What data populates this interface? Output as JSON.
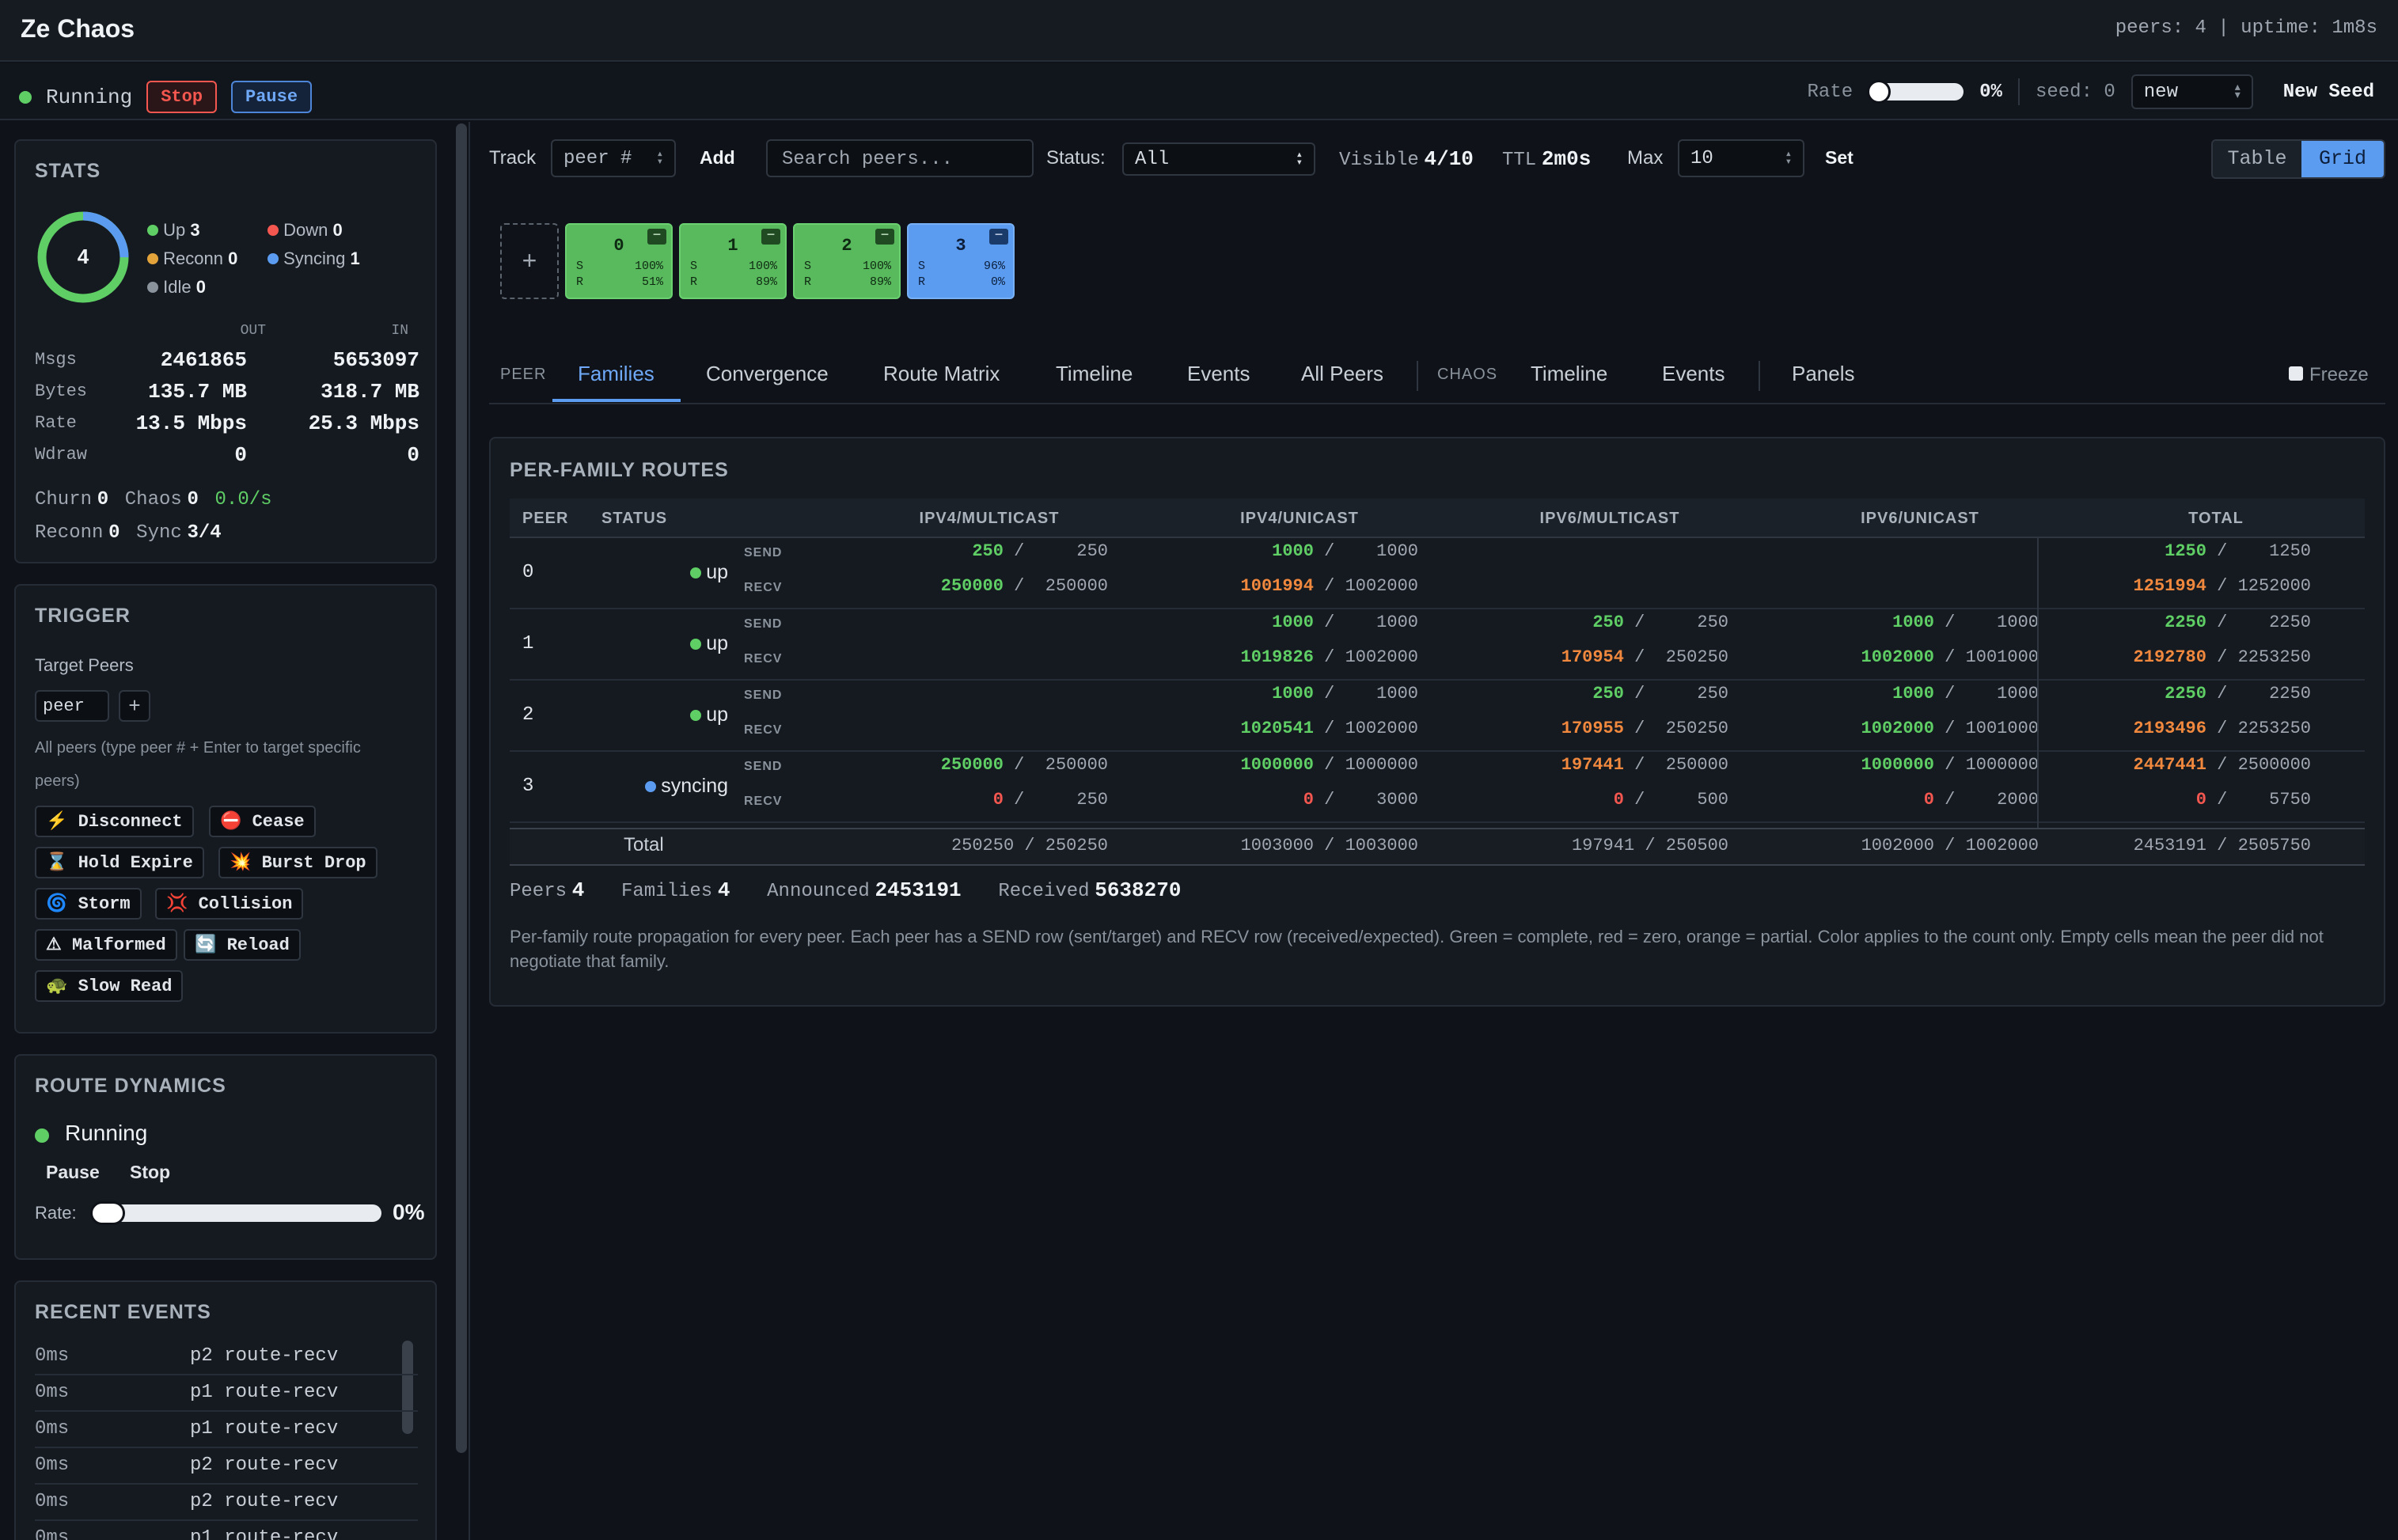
{
  "app": {
    "title": "Ze Chaos",
    "status_line": "peers: 4 | uptime: 1m8s"
  },
  "control": {
    "status": "Running",
    "stop": "Stop",
    "pause": "Pause",
    "rate_label": "Rate",
    "rate_value": "0%",
    "rate_level": 0,
    "seed_label": "seed: 0",
    "seed_mode": "new",
    "new_seed": "New Seed"
  },
  "stats": {
    "title": "STATS",
    "total": "4",
    "legend": [
      {
        "label": "Up",
        "value": "3",
        "color": "#5fcf65"
      },
      {
        "label": "Down",
        "value": "0",
        "color": "#f4574f"
      },
      {
        "label": "Reconn",
        "value": "0",
        "color": "#e3a33b"
      },
      {
        "label": "Syncing",
        "value": "1",
        "color": "#5b9cf0"
      },
      {
        "label": "Idle",
        "value": "0",
        "color": "#8a929c"
      }
    ],
    "col_out": "OUT",
    "col_in": "IN",
    "rows": [
      {
        "label": "Msgs",
        "out": "2461865",
        "in": "5653097"
      },
      {
        "label": "Bytes",
        "out": "135.7 MB",
        "in": "318.7 MB"
      },
      {
        "label": "Rate",
        "out": "13.5 Mbps",
        "in": "25.3 Mbps"
      },
      {
        "label": "Wdraw",
        "out": "0",
        "in": "0"
      }
    ],
    "churn_label": "Churn",
    "churn": "0",
    "chaos_label": "Chaos",
    "chaos": "0",
    "chaos_rate": "0.0/s",
    "reconn_label": "Reconn",
    "reconn": "0",
    "sync_label": "Sync",
    "sync": "3/4"
  },
  "trigger": {
    "title": "TRIGGER",
    "target_label": "Target Peers",
    "peer_input": "peer",
    "add": "+",
    "hint": "All peers (type peer # + Enter to target specific",
    "hint2": "peers)",
    "buttons": [
      {
        "icon": "⚡",
        "label": "Disconnect"
      },
      {
        "icon": "⛔",
        "label": "Cease"
      },
      {
        "icon": "⌛",
        "label": "Hold Expire"
      },
      {
        "icon": "💥",
        "label": "Burst Drop"
      },
      {
        "icon": "🌀",
        "label": "Storm"
      },
      {
        "icon": "💢",
        "label": "Collision"
      },
      {
        "icon": "⚠",
        "label": "Malformed"
      },
      {
        "icon": "🔄",
        "label": "Reload"
      },
      {
        "icon": "🐢",
        "label": "Slow Read"
      }
    ]
  },
  "dynamics": {
    "title": "ROUTE DYNAMICS",
    "status": "Running",
    "pause": "Pause",
    "stop": "Stop",
    "rate_label": "Rate:",
    "rate_value": "0%",
    "rate_level": 0
  },
  "events": {
    "title": "RECENT EVENTS",
    "rows": [
      {
        "time": "0ms",
        "text": "p2 route-recv"
      },
      {
        "time": "0ms",
        "text": "p1 route-recv"
      },
      {
        "time": "0ms",
        "text": "p1 route-recv"
      },
      {
        "time": "0ms",
        "text": "p2 route-recv"
      },
      {
        "time": "0ms",
        "text": "p2 route-recv"
      },
      {
        "time": "0ms",
        "text": "p1 route-recv"
      }
    ]
  },
  "toolbar": {
    "track": "Track",
    "track_placeholder": "peer #",
    "add": "Add",
    "search_placeholder": "Search peers...",
    "status_label": "Status:",
    "status_value": "All",
    "visible_label": "Visible",
    "visible": "4/10",
    "ttl_label": "TTL",
    "ttl": "2m0s",
    "max_label": "Max",
    "max": "10",
    "set": "Set",
    "view_table": "Table",
    "view_grid": "Grid"
  },
  "peer_cards": [
    {
      "id": "0",
      "s": "100%",
      "r": "51%",
      "state": "up"
    },
    {
      "id": "1",
      "s": "100%",
      "r": "89%",
      "state": "up"
    },
    {
      "id": "2",
      "s": "100%",
      "r": "89%",
      "state": "up"
    },
    {
      "id": "3",
      "s": "96%",
      "r": "0%",
      "state": "syncing"
    }
  ],
  "card_labels": {
    "s": "S",
    "r": "R",
    "add": "+",
    "min": "−"
  },
  "tabs": {
    "peer_group": "PEER",
    "peer_tabs": [
      "Families",
      "Convergence",
      "Route Matrix",
      "Timeline",
      "Events",
      "All Peers"
    ],
    "chaos_group": "CHAOS",
    "chaos_tabs": [
      "Timeline",
      "Events"
    ],
    "panels": "Panels",
    "freeze": "Freeze"
  },
  "routes": {
    "title": "PER-FAMILY ROUTES",
    "headers": [
      "PEER",
      "STATUS",
      "IPV4/MULTICAST",
      "IPV4/UNICAST",
      "IPV6/MULTICAST",
      "IPV6/UNICAST",
      "TOTAL"
    ],
    "send": "SEND",
    "recv": "RECV",
    "peers": [
      {
        "peer": "0",
        "status": "up",
        "send": [
          [
            "250",
            "250",
            "green"
          ],
          [
            "1000",
            "1000",
            "green"
          ],
          null,
          null,
          [
            "1250",
            "1250",
            "green"
          ]
        ],
        "recv": [
          [
            "250000",
            "250000",
            "green"
          ],
          [
            "1001994",
            "1002000",
            "orange"
          ],
          null,
          null,
          [
            "1251994",
            "1252000",
            "orange"
          ]
        ]
      },
      {
        "peer": "1",
        "status": "up",
        "send": [
          null,
          [
            "1000",
            "1000",
            "green"
          ],
          [
            "250",
            "250",
            "green"
          ],
          [
            "1000",
            "1000",
            "green"
          ],
          [
            "2250",
            "2250",
            "green"
          ]
        ],
        "recv": [
          null,
          [
            "1019826",
            "1002000",
            "green"
          ],
          [
            "170954",
            "250250",
            "orange"
          ],
          [
            "1002000",
            "1001000",
            "green"
          ],
          [
            "2192780",
            "2253250",
            "orange"
          ]
        ]
      },
      {
        "peer": "2",
        "status": "up",
        "send": [
          null,
          [
            "1000",
            "1000",
            "green"
          ],
          [
            "250",
            "250",
            "green"
          ],
          [
            "1000",
            "1000",
            "green"
          ],
          [
            "2250",
            "2250",
            "green"
          ]
        ],
        "recv": [
          null,
          [
            "1020541",
            "1002000",
            "green"
          ],
          [
            "170955",
            "250250",
            "orange"
          ],
          [
            "1002000",
            "1001000",
            "green"
          ],
          [
            "2193496",
            "2253250",
            "orange"
          ]
        ]
      },
      {
        "peer": "3",
        "status": "syncing",
        "send": [
          [
            "250000",
            "250000",
            "green"
          ],
          [
            "1000000",
            "1000000",
            "green"
          ],
          [
            "197441",
            "250000",
            "orange"
          ],
          [
            "1000000",
            "1000000",
            "green"
          ],
          [
            "2447441",
            "2500000",
            "orange"
          ]
        ],
        "recv": [
          [
            "0",
            "250",
            "red"
          ],
          [
            "0",
            "3000",
            "red"
          ],
          [
            "0",
            "500",
            "red"
          ],
          [
            "0",
            "2000",
            "red"
          ],
          [
            "0",
            "5750",
            "red"
          ]
        ]
      }
    ],
    "total_label": "Total",
    "totals": [
      "250250 / 250250",
      "1003000 / 1003000",
      "197941 / 250500",
      "1002000 / 1002000",
      "2453191 / 2505750"
    ],
    "summary": [
      {
        "label": "Peers",
        "value": "4"
      },
      {
        "label": "Families",
        "value": "4"
      },
      {
        "label": "Announced",
        "value": "2453191"
      },
      {
        "label": "Received",
        "value": "5638270"
      }
    ],
    "note": "Per-family route propagation for every peer. Each peer has a SEND row (sent/target) and RECV row (received/expected). Green = complete, red = zero, orange = partial. Color applies to the count only. Empty cells mean the peer did not negotiate that family."
  }
}
